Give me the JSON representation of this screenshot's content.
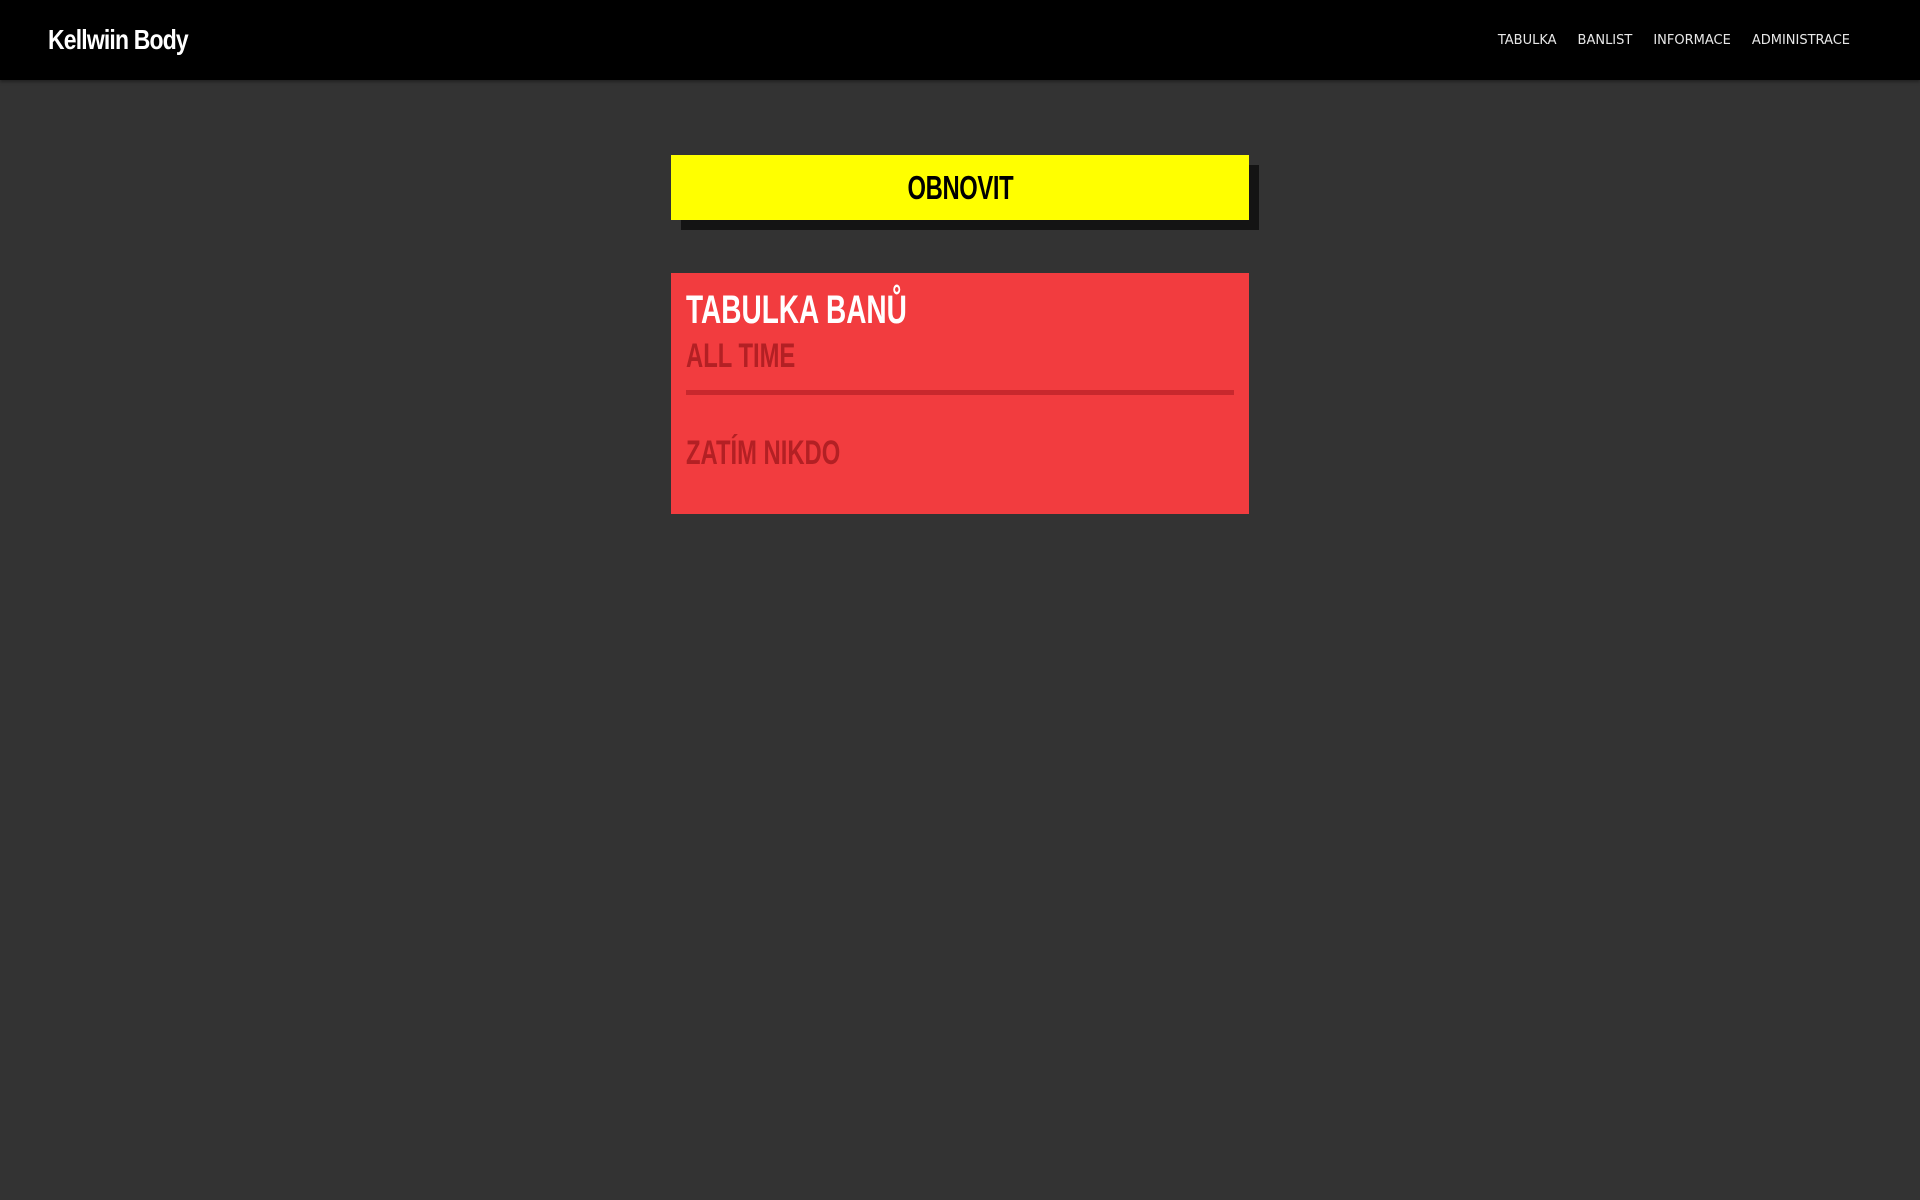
{
  "navbar": {
    "brand": "Kellwiin Body",
    "links": [
      {
        "label": "TABULKA"
      },
      {
        "label": "BANLIST"
      },
      {
        "label": "INFORMACE"
      },
      {
        "label": "ADMINISTRACE"
      }
    ]
  },
  "refresh": {
    "label": "OBNOVIT"
  },
  "ban_table": {
    "title": "TABULKA BANŮ",
    "subtitle": "ALL TIME",
    "empty_message": "ZATÍM NIKDO"
  },
  "colors": {
    "navbar_bg": "#000000",
    "page_bg": "#333333",
    "accent_yellow": "#ffff00",
    "card_red": "#f23c3f",
    "muted_red_text": "#b32024"
  }
}
